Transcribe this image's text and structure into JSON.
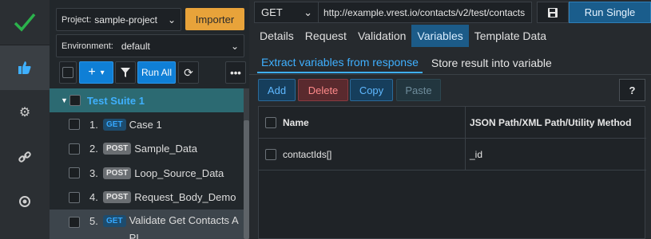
{
  "project": {
    "label": "Project:",
    "value": "sample-project"
  },
  "importer_label": "Importer",
  "environment": {
    "label": "Environment:",
    "value": "default"
  },
  "toolbar": {
    "run_all_label": "Run All"
  },
  "tree": {
    "suite_name": "Test Suite 1",
    "cases": [
      {
        "num": "1.",
        "method": "GET",
        "name": "Case 1"
      },
      {
        "num": "2.",
        "method": "POST",
        "name": "Sample_Data"
      },
      {
        "num": "3.",
        "method": "POST",
        "name": "Loop_Source_Data"
      },
      {
        "num": "4.",
        "method": "POST",
        "name": "Request_Body_Demo"
      },
      {
        "num": "5.",
        "method": "GET",
        "name": "Validate Get Contacts A PI"
      }
    ]
  },
  "request": {
    "method": "GET",
    "url": "http://example.vrest.io/contacts/v2/test/contacts",
    "run_single_label": "Run Single"
  },
  "tabs": [
    "Details",
    "Request",
    "Validation",
    "Variables",
    "Template Data"
  ],
  "active_tab": "Variables",
  "subtabs": [
    "Extract variables from response",
    "Store result into variable"
  ],
  "actions": {
    "add": "Add",
    "delete": "Delete",
    "copy": "Copy",
    "paste": "Paste",
    "help": "?"
  },
  "table": {
    "headers": [
      "Name",
      "JSON Path/XML Path/Utility Method"
    ],
    "rows": [
      {
        "name": "contactIds[]",
        "path": "_id"
      }
    ]
  },
  "colors": {
    "accent": "#3fb0ff",
    "importer": "#e8a33a",
    "suite_bg": "#2c6a72",
    "check": "#2bb24c"
  },
  "icons": [
    "check-icon",
    "thumbs-up-icon",
    "gear-icon",
    "link-icon",
    "target-icon",
    "plus-icon",
    "filter-icon",
    "refresh-icon",
    "more-icon",
    "save-icon"
  ]
}
